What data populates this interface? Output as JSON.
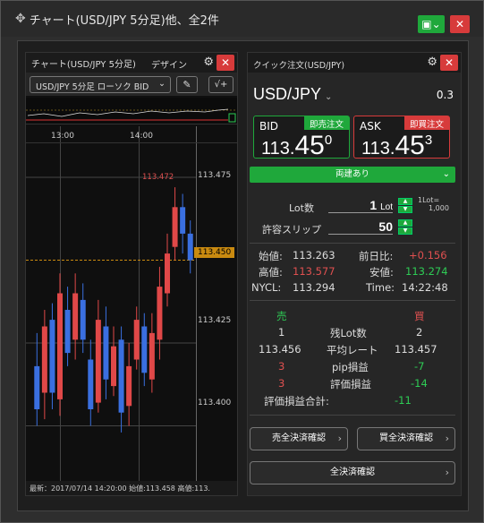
{
  "window": {
    "title": "チャート(USD/JPY 5分足)他、全2件"
  },
  "chart_panel": {
    "title": "チャート(USD/JPY 5分足)",
    "design_label": "デザイン",
    "symbol_select": "USD/JPY 5分足 ローソク BID",
    "time_labels": [
      "13:00",
      "14:00"
    ],
    "y_labels": [
      "113.475",
      "113.450",
      "113.425",
      "113.400"
    ],
    "last_price_tag": "113.450",
    "high_marker": "113.472",
    "footer": "最新：2017/07/14 14:20:00 始値:113.458 高値:113."
  },
  "chart_data": {
    "type": "candlestick",
    "title": "",
    "ylim": [
      113.385,
      113.485
    ],
    "candles": [
      {
        "o": 113.418,
        "c": 113.405,
        "h": 113.428,
        "l": 113.4
      },
      {
        "o": 113.41,
        "c": 113.43,
        "h": 113.435,
        "l": 113.402
      },
      {
        "o": 113.432,
        "c": 113.41,
        "h": 113.437,
        "l": 113.405
      },
      {
        "o": 113.408,
        "c": 113.44,
        "h": 113.446,
        "l": 113.403
      },
      {
        "o": 113.435,
        "c": 113.422,
        "h": 113.442,
        "l": 113.418
      },
      {
        "o": 113.426,
        "c": 113.44,
        "h": 113.446,
        "l": 113.42
      },
      {
        "o": 113.438,
        "c": 113.426,
        "h": 113.443,
        "l": 113.422
      },
      {
        "o": 113.42,
        "c": 113.405,
        "h": 113.426,
        "l": 113.4
      },
      {
        "o": 113.407,
        "c": 113.432,
        "h": 113.438,
        "l": 113.404
      },
      {
        "o": 113.43,
        "c": 113.414,
        "h": 113.436,
        "l": 113.408
      },
      {
        "o": 113.412,
        "c": 113.424,
        "h": 113.43,
        "l": 113.409
      },
      {
        "o": 113.426,
        "c": 113.404,
        "h": 113.43,
        "l": 113.398
      },
      {
        "o": 113.406,
        "c": 113.418,
        "h": 113.425,
        "l": 113.4
      },
      {
        "o": 113.42,
        "c": 113.432,
        "h": 113.436,
        "l": 113.417
      },
      {
        "o": 113.43,
        "c": 113.416,
        "h": 113.434,
        "l": 113.412
      },
      {
        "o": 113.414,
        "c": 113.428,
        "h": 113.434,
        "l": 113.41
      },
      {
        "o": 113.426,
        "c": 113.442,
        "h": 113.448,
        "l": 113.42
      },
      {
        "o": 113.44,
        "c": 113.452,
        "h": 113.458,
        "l": 113.436
      },
      {
        "o": 113.454,
        "c": 113.466,
        "h": 113.472,
        "l": 113.45
      },
      {
        "o": 113.466,
        "c": 113.458,
        "h": 113.47,
        "l": 113.452
      },
      {
        "o": 113.458,
        "c": 113.45,
        "h": 113.462,
        "l": 113.446
      }
    ]
  },
  "order_panel": {
    "title": "クイック注文(USD/JPY)",
    "pair": "USD/JPY",
    "pair_caret": "⌄",
    "spread": "0.3",
    "bid_label": "BID",
    "bid_tag": "即売注文",
    "bid_price_a": "113.",
    "bid_price_b": "45",
    "bid_price_c": "0",
    "ask_label": "ASK",
    "ask_tag": "即買注文",
    "ask_price_a": "113.",
    "ask_price_b": "45",
    "ask_price_c": "3",
    "combo_label": "両建あり",
    "lot_label": "Lot数",
    "lot_value": "1",
    "lot_unit": "Lot",
    "lot_note_1": "1Lot=",
    "lot_note_2": "1,000",
    "slippage_label": "許容スリップ",
    "slippage_value": "50",
    "open_label": "始値:",
    "open_value": "113.263",
    "change_label": "前日比:",
    "change_value": "+0.156",
    "high_label": "高値:",
    "high_value": "113.577",
    "low_label": "安値:",
    "low_value": "113.274",
    "nycl_label": "NYCL:",
    "nycl_value": "113.294",
    "time_label": "Time:",
    "time_value": "14:22:48",
    "sell_header": "売",
    "buy_header": "買",
    "remaining_label": "残Lot数",
    "remaining_sell": "1",
    "remaining_buy": "2",
    "avg_label": "平均レート",
    "avg_sell": "113.456",
    "avg_buy": "113.457",
    "pip_label": "pip損益",
    "pip_sell": "3",
    "pip_buy": "-7",
    "eval_label": "評価損益",
    "eval_sell": "3",
    "eval_buy": "-14",
    "total_label": "評価損益合計:",
    "total_value": "-11",
    "close_sell_btn": "売全決済確認",
    "close_buy_btn": "買全決済確認",
    "close_all_btn": "全決済確認"
  }
}
